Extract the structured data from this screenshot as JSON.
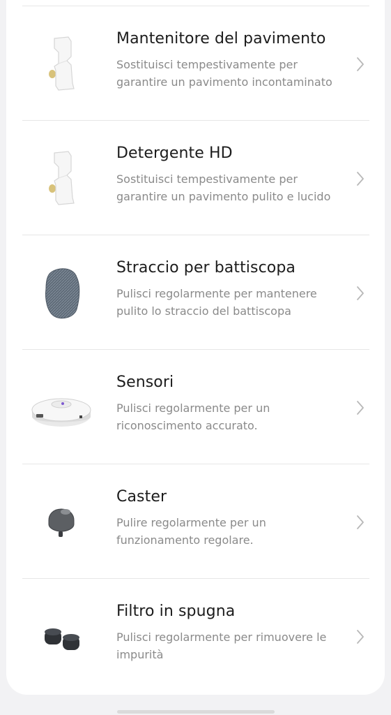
{
  "items": [
    {
      "title": "Mantenitore del pavimento",
      "desc_line1": "Sostituisci tempestivamente per",
      "desc_line2": "garantire un pavimento incontaminato",
      "icon": "floor-cleaner-bottle-icon"
    },
    {
      "title": "Detergente HD",
      "desc_line1": "Sostituisci tempestivamente per",
      "desc_line2": "garantire un pavimento pulito e lucido",
      "icon": "hd-detergent-bottle-icon"
    },
    {
      "title": "Straccio per battiscopa",
      "desc_line1": "Pulisci regolarmente per mantenere",
      "desc_line2": "pulito lo straccio del battiscopa",
      "icon": "baseboard-mop-icon"
    },
    {
      "title": "Sensori",
      "desc_line1": "Pulisci regolarmente per un",
      "desc_line2": "riconoscimento accurato.",
      "icon": "robot-vacuum-sensor-icon"
    },
    {
      "title": "Caster",
      "desc_line1": "Pulire regolarmente per un",
      "desc_line2": "funzionamento regolare.",
      "icon": "caster-wheel-icon"
    },
    {
      "title": "Filtro in spugna",
      "desc_line1": "Pulisci regolarmente per rimuovere le",
      "desc_line2": "impurità",
      "icon": "sponge-filter-icon"
    }
  ],
  "colors": {
    "background": "#f2f2f4",
    "card": "#ffffff",
    "title": "#1c1c1c",
    "description": "#8a8a8a",
    "divider": "#e6e6e6",
    "chevron": "#b8b8b8"
  }
}
